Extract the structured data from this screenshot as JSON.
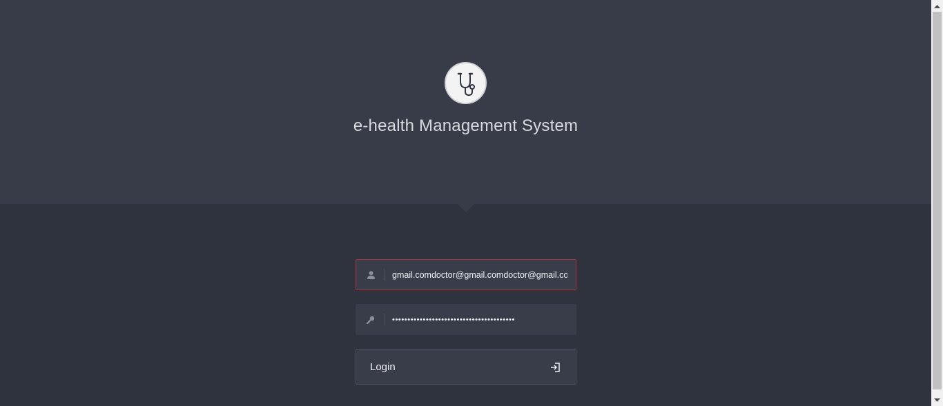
{
  "app": {
    "title": "e-health Management System",
    "logo_icon": "stethoscope-icon"
  },
  "login_form": {
    "email": {
      "icon": "user-icon",
      "value": "gmail.comdoctor@gmail.comdoctor@gmail.com"
    },
    "password": {
      "icon": "key-icon",
      "value": "••••••••••••••••••••••••••••••••••••••••"
    },
    "login_button": {
      "label": "Login",
      "icon": "sign-in-icon"
    }
  },
  "colors": {
    "header_bg": "#373c48",
    "page_bg": "#2e333e",
    "field_bg": "#383d49",
    "error_border": "#a8333f"
  }
}
